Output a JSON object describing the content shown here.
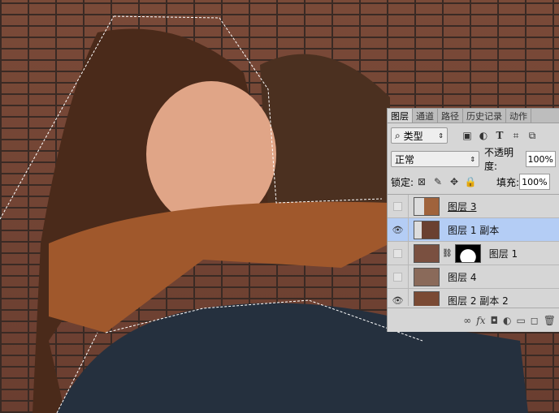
{
  "tabs": [
    "图层",
    "通道",
    "路径",
    "历史记录",
    "动作"
  ],
  "filter": {
    "label": "类型"
  },
  "blend": {
    "mode": "正常",
    "opacity_label": "不透明度:",
    "opacity": "100%"
  },
  "lock": {
    "label": "锁定:",
    "fill_label": "填充:",
    "fill": "100%"
  },
  "layers": [
    {
      "name": "图层 3",
      "visible": false
    },
    {
      "name": "图层 1 副本",
      "visible": true,
      "selected": true
    },
    {
      "name": "图层 1",
      "visible": false
    },
    {
      "name": "图层 4",
      "visible": false
    },
    {
      "name": "图层 2 副本 2",
      "visible": true
    }
  ],
  "icons": {
    "eye": "👁",
    "link": "⛓",
    "fx": "fx",
    "trash": "🗑"
  }
}
